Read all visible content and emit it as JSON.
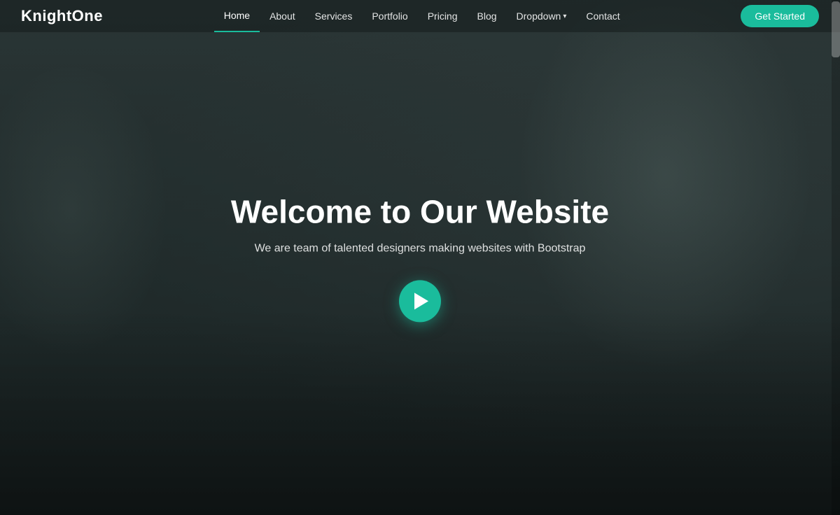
{
  "brand": {
    "name": "KnightOne"
  },
  "navbar": {
    "items": [
      {
        "label": "Home",
        "active": true,
        "hasDropdown": false
      },
      {
        "label": "About",
        "active": false,
        "hasDropdown": false
      },
      {
        "label": "Services",
        "active": false,
        "hasDropdown": false
      },
      {
        "label": "Portfolio",
        "active": false,
        "hasDropdown": false
      },
      {
        "label": "Pricing",
        "active": false,
        "hasDropdown": false
      },
      {
        "label": "Blog",
        "active": false,
        "hasDropdown": false
      },
      {
        "label": "Dropdown",
        "active": false,
        "hasDropdown": true
      },
      {
        "label": "Contact",
        "active": false,
        "hasDropdown": false
      }
    ],
    "cta_label": "Get Started"
  },
  "hero": {
    "title": "Welcome to Our Website",
    "subtitle": "We are team of talented designers making websites with Bootstrap",
    "play_button_label": "Play Video"
  },
  "colors": {
    "accent": "#1abc9c",
    "navbar_bg": "rgba(20,28,28,0.55)",
    "text_primary": "#ffffff",
    "text_secondary": "rgba(255,255,255,0.85)"
  }
}
